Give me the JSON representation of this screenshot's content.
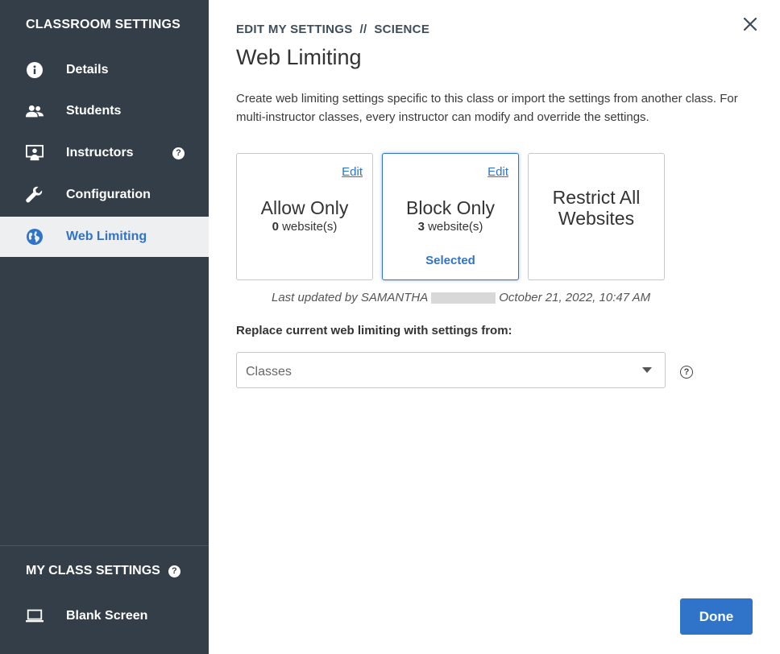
{
  "sidebar": {
    "title": "CLASSROOM SETTINGS",
    "items": [
      {
        "label": "Details",
        "icon": "info-icon"
      },
      {
        "label": "Students",
        "icon": "people-icon"
      },
      {
        "label": "Instructors",
        "icon": "presenter-icon",
        "help": "?"
      },
      {
        "label": "Configuration",
        "icon": "wrench-icon"
      },
      {
        "label": "Web Limiting",
        "icon": "globe-icon",
        "active": true
      }
    ],
    "my_class_settings": {
      "title": "MY CLASS SETTINGS",
      "help": "?",
      "items": [
        {
          "label": "Blank Screen",
          "icon": "laptop-icon"
        }
      ]
    }
  },
  "main": {
    "breadcrumb": "EDIT MY SETTINGS  //  SCIENCE",
    "title": "Web Limiting",
    "description": "Create web limiting settings specific to this class or import the settings from another class. For multi-instructor classes, every instructor can modify and override the settings.",
    "cards": [
      {
        "title": "Allow Only",
        "count": "0",
        "count_suffix": " website(s)",
        "edit": "Edit",
        "selected": false
      },
      {
        "title": "Block Only",
        "count": "3",
        "count_suffix": " website(s)",
        "edit": "Edit",
        "selected": true,
        "selected_label": "Selected"
      },
      {
        "title_line1": "Restrict All",
        "title_line2": "Websites",
        "selected": false
      }
    ],
    "last_updated_prefix": "Last updated by SAMANTHA",
    "last_updated_suffix": "October 21, 2022, 10:47 AM",
    "replace_label": "Replace current web limiting with settings from:",
    "select_placeholder": "Classes",
    "select_help": "?",
    "done_label": "Done"
  },
  "colors": {
    "sidebar_bg": "#343e48",
    "accent": "#2f74c9",
    "active_item_bg": "#eeeff0"
  }
}
